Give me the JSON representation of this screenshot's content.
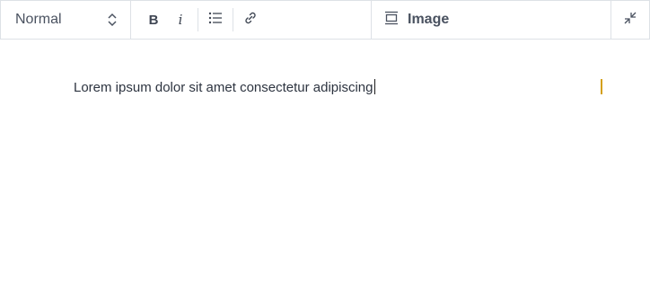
{
  "toolbar": {
    "style_select": {
      "value": "Normal"
    },
    "format": {
      "bold_label": "B",
      "italic_label": "i",
      "list_icon": "bullet-list-icon",
      "link_icon": "link-icon"
    },
    "insert": {
      "image_label": "Image",
      "image_icon": "image-block-icon"
    },
    "fullscreen_icon": "collapse-icon"
  },
  "editor": {
    "text": "Lorem ipsum dolor sit amet consectetur adipiscing"
  },
  "colors": {
    "border": "#dde1e6",
    "text": "#2d3440",
    "marker": "#d4a017"
  }
}
